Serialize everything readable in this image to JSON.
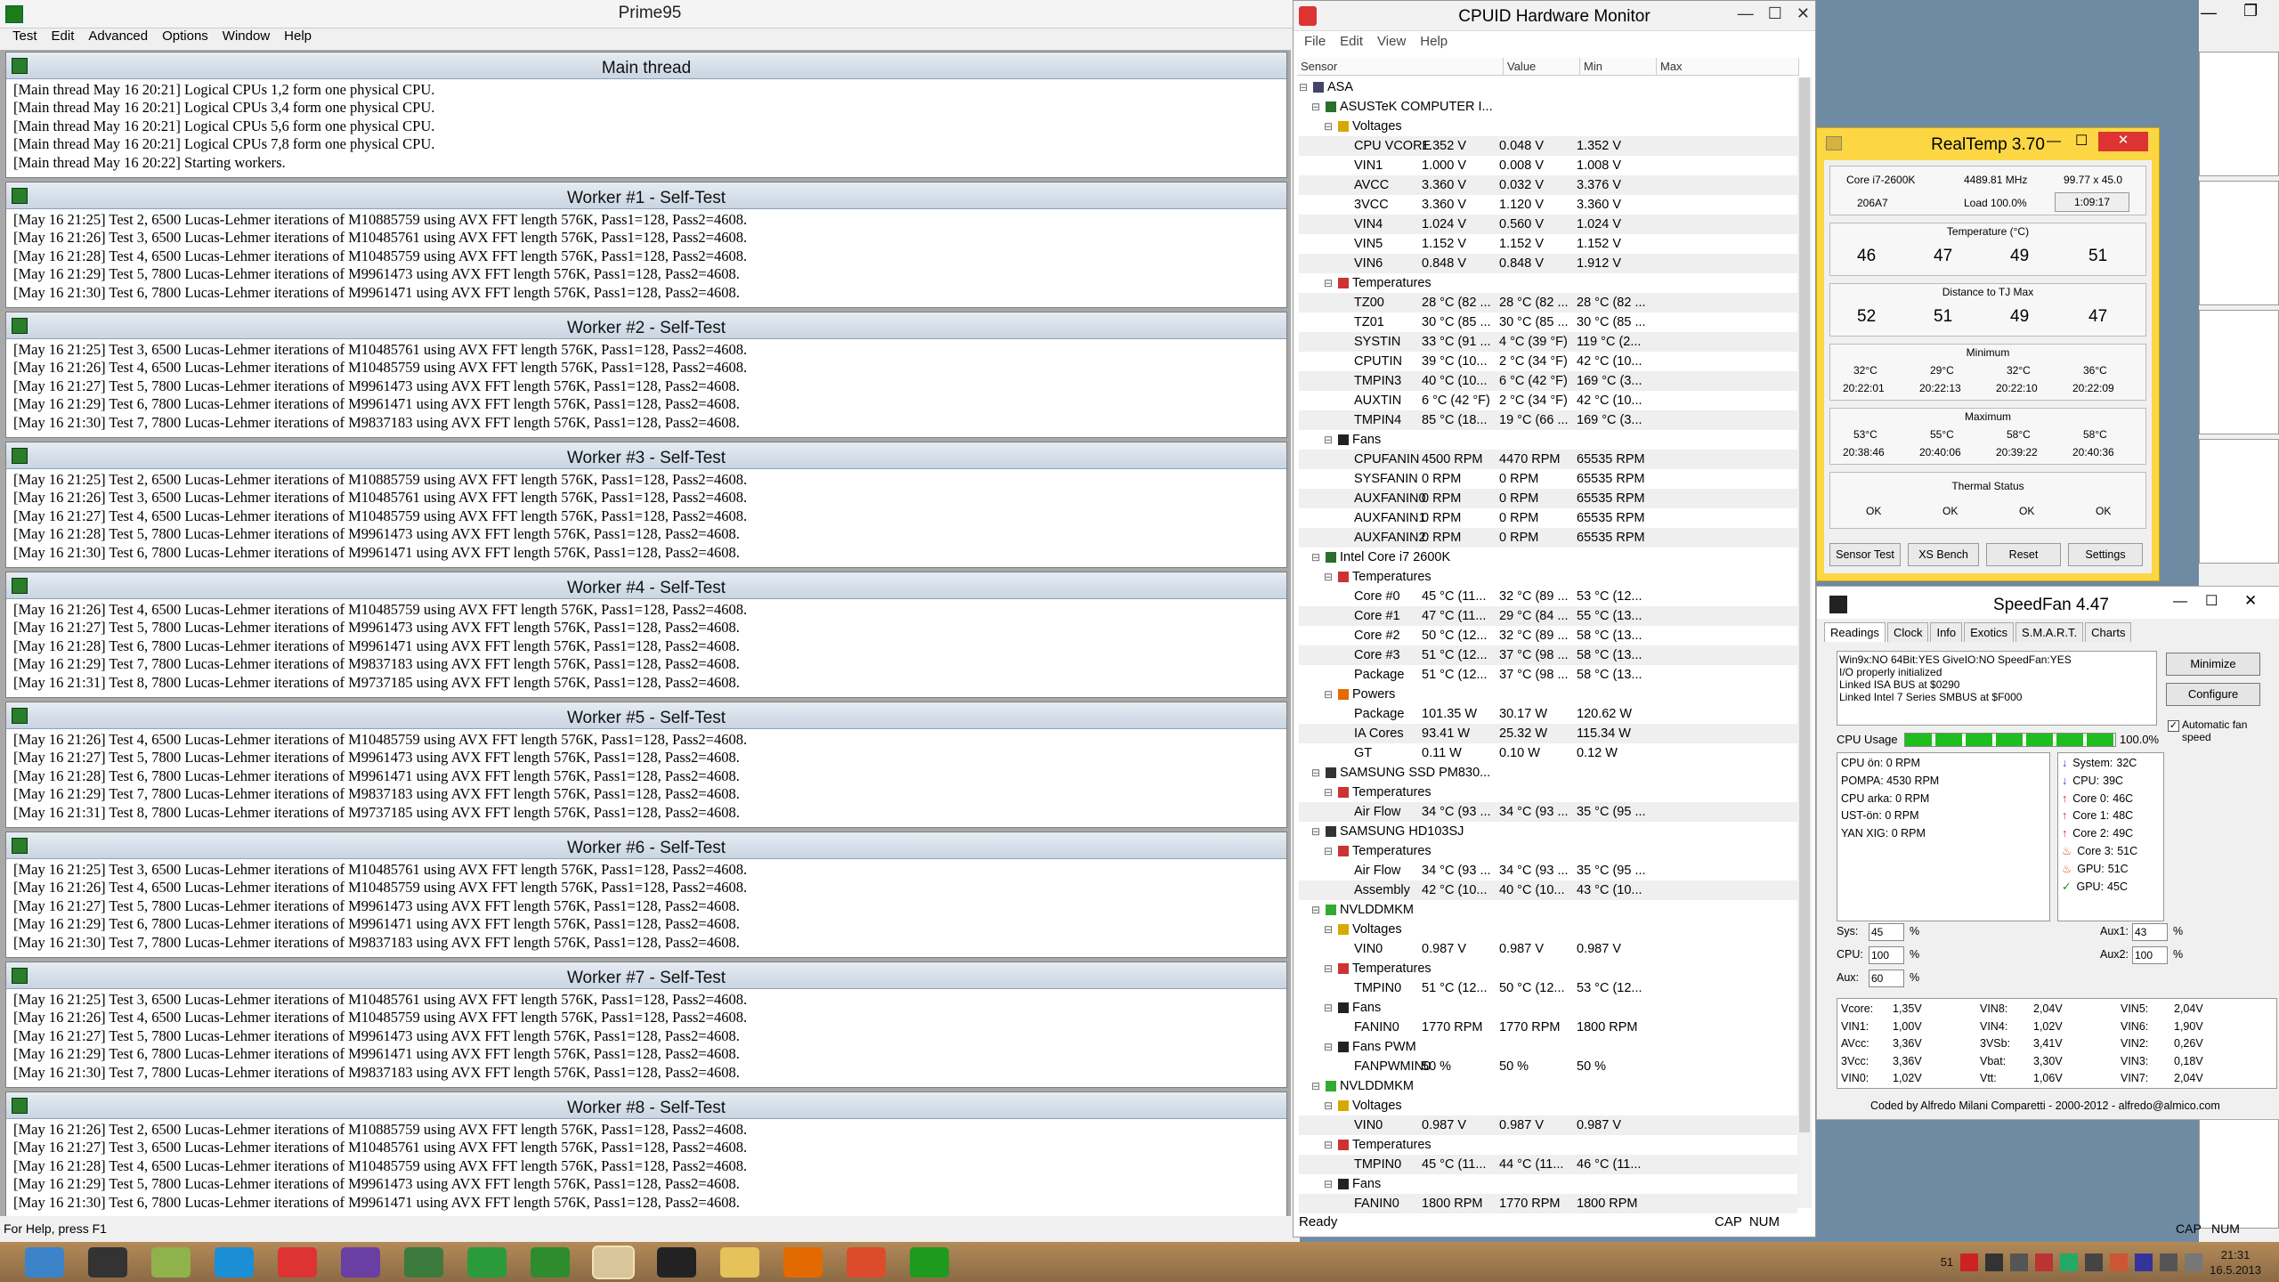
{
  "prime95": {
    "title": "Prime95",
    "menu": [
      "Test",
      "Edit",
      "Advanced",
      "Options",
      "Window",
      "Help"
    ],
    "panes": [
      {
        "title": "Main thread",
        "lines": [
          "[Main thread May 16 20:21] Logical CPUs 1,2 form one physical CPU.",
          "[Main thread May 16 20:21] Logical CPUs 3,4 form one physical CPU.",
          "[Main thread May 16 20:21] Logical CPUs 5,6 form one physical CPU.",
          "[Main thread May 16 20:21] Logical CPUs 7,8 form one physical CPU.",
          "[Main thread May 16 20:22] Starting workers."
        ]
      },
      {
        "title": "Worker #1 - Self-Test",
        "lines": [
          "[May 16 21:25] Test 2, 6500 Lucas-Lehmer iterations of M10885759 using AVX FFT length 576K, Pass1=128, Pass2=4608.",
          "[May 16 21:26] Test 3, 6500 Lucas-Lehmer iterations of M10485761 using AVX FFT length 576K, Pass1=128, Pass2=4608.",
          "[May 16 21:28] Test 4, 6500 Lucas-Lehmer iterations of M10485759 using AVX FFT length 576K, Pass1=128, Pass2=4608.",
          "[May 16 21:29] Test 5, 7800 Lucas-Lehmer iterations of M9961473 using AVX FFT length 576K, Pass1=128, Pass2=4608.",
          "[May 16 21:30] Test 6, 7800 Lucas-Lehmer iterations of M9961471 using AVX FFT length 576K, Pass1=128, Pass2=4608."
        ]
      },
      {
        "title": "Worker #2 - Self-Test",
        "lines": [
          "[May 16 21:25] Test 3, 6500 Lucas-Lehmer iterations of M10485761 using AVX FFT length 576K, Pass1=128, Pass2=4608.",
          "[May 16 21:26] Test 4, 6500 Lucas-Lehmer iterations of M10485759 using AVX FFT length 576K, Pass1=128, Pass2=4608.",
          "[May 16 21:27] Test 5, 7800 Lucas-Lehmer iterations of M9961473 using AVX FFT length 576K, Pass1=128, Pass2=4608.",
          "[May 16 21:29] Test 6, 7800 Lucas-Lehmer iterations of M9961471 using AVX FFT length 576K, Pass1=128, Pass2=4608.",
          "[May 16 21:30] Test 7, 7800 Lucas-Lehmer iterations of M9837183 using AVX FFT length 576K, Pass1=128, Pass2=4608."
        ]
      },
      {
        "title": "Worker #3 - Self-Test",
        "lines": [
          "[May 16 21:25] Test 2, 6500 Lucas-Lehmer iterations of M10885759 using AVX FFT length 576K, Pass1=128, Pass2=4608.",
          "[May 16 21:26] Test 3, 6500 Lucas-Lehmer iterations of M10485761 using AVX FFT length 576K, Pass1=128, Pass2=4608.",
          "[May 16 21:27] Test 4, 6500 Lucas-Lehmer iterations of M10485759 using AVX FFT length 576K, Pass1=128, Pass2=4608.",
          "[May 16 21:28] Test 5, 7800 Lucas-Lehmer iterations of M9961473 using AVX FFT length 576K, Pass1=128, Pass2=4608.",
          "[May 16 21:30] Test 6, 7800 Lucas-Lehmer iterations of M9961471 using AVX FFT length 576K, Pass1=128, Pass2=4608."
        ]
      },
      {
        "title": "Worker #4 - Self-Test",
        "lines": [
          "[May 16 21:26] Test 4, 6500 Lucas-Lehmer iterations of M10485759 using AVX FFT length 576K, Pass1=128, Pass2=4608.",
          "[May 16 21:27] Test 5, 7800 Lucas-Lehmer iterations of M9961473 using AVX FFT length 576K, Pass1=128, Pass2=4608.",
          "[May 16 21:28] Test 6, 7800 Lucas-Lehmer iterations of M9961471 using AVX FFT length 576K, Pass1=128, Pass2=4608.",
          "[May 16 21:29] Test 7, 7800 Lucas-Lehmer iterations of M9837183 using AVX FFT length 576K, Pass1=128, Pass2=4608.",
          "[May 16 21:31] Test 8, 7800 Lucas-Lehmer iterations of M9737185 using AVX FFT length 576K, Pass1=128, Pass2=4608."
        ]
      },
      {
        "title": "Worker #5 - Self-Test",
        "lines": [
          "[May 16 21:26] Test 4, 6500 Lucas-Lehmer iterations of M10485759 using AVX FFT length 576K, Pass1=128, Pass2=4608.",
          "[May 16 21:27] Test 5, 7800 Lucas-Lehmer iterations of M9961473 using AVX FFT length 576K, Pass1=128, Pass2=4608.",
          "[May 16 21:28] Test 6, 7800 Lucas-Lehmer iterations of M9961471 using AVX FFT length 576K, Pass1=128, Pass2=4608.",
          "[May 16 21:29] Test 7, 7800 Lucas-Lehmer iterations of M9837183 using AVX FFT length 576K, Pass1=128, Pass2=4608.",
          "[May 16 21:31] Test 8, 7800 Lucas-Lehmer iterations of M9737185 using AVX FFT length 576K, Pass1=128, Pass2=4608."
        ]
      },
      {
        "title": "Worker #6 - Self-Test",
        "lines": [
          "[May 16 21:25] Test 3, 6500 Lucas-Lehmer iterations of M10485761 using AVX FFT length 576K, Pass1=128, Pass2=4608.",
          "[May 16 21:26] Test 4, 6500 Lucas-Lehmer iterations of M10485759 using AVX FFT length 576K, Pass1=128, Pass2=4608.",
          "[May 16 21:27] Test 5, 7800 Lucas-Lehmer iterations of M9961473 using AVX FFT length 576K, Pass1=128, Pass2=4608.",
          "[May 16 21:29] Test 6, 7800 Lucas-Lehmer iterations of M9961471 using AVX FFT length 576K, Pass1=128, Pass2=4608.",
          "[May 16 21:30] Test 7, 7800 Lucas-Lehmer iterations of M9837183 using AVX FFT length 576K, Pass1=128, Pass2=4608."
        ]
      },
      {
        "title": "Worker #7 - Self-Test",
        "lines": [
          "[May 16 21:25] Test 3, 6500 Lucas-Lehmer iterations of M10485761 using AVX FFT length 576K, Pass1=128, Pass2=4608.",
          "[May 16 21:26] Test 4, 6500 Lucas-Lehmer iterations of M10485759 using AVX FFT length 576K, Pass1=128, Pass2=4608.",
          "[May 16 21:27] Test 5, 7800 Lucas-Lehmer iterations of M9961473 using AVX FFT length 576K, Pass1=128, Pass2=4608.",
          "[May 16 21:29] Test 6, 7800 Lucas-Lehmer iterations of M9961471 using AVX FFT length 576K, Pass1=128, Pass2=4608.",
          "[May 16 21:30] Test 7, 7800 Lucas-Lehmer iterations of M9837183 using AVX FFT length 576K, Pass1=128, Pass2=4608."
        ]
      },
      {
        "title": "Worker #8 - Self-Test",
        "lines": [
          "[May 16 21:26] Test 2, 6500 Lucas-Lehmer iterations of M10885759 using AVX FFT length 576K, Pass1=128, Pass2=4608.",
          "[May 16 21:27] Test 3, 6500 Lucas-Lehmer iterations of M10485761 using AVX FFT length 576K, Pass1=128, Pass2=4608.",
          "[May 16 21:28] Test 4, 6500 Lucas-Lehmer iterations of M10485759 using AVX FFT length 576K, Pass1=128, Pass2=4608.",
          "[May 16 21:29] Test 5, 7800 Lucas-Lehmer iterations of M9961473 using AVX FFT length 576K, Pass1=128, Pass2=4608.",
          "[May 16 21:30] Test 6, 7800 Lucas-Lehmer iterations of M9961471 using AVX FFT length 576K, Pass1=128, Pass2=4608."
        ]
      }
    ],
    "status": "For Help, press F1",
    "caps": "CAP",
    "num": "NUM"
  },
  "cpuid": {
    "title": "CPUID Hardware Monitor",
    "menu": [
      "File",
      "Edit",
      "View",
      "Help"
    ],
    "columns": [
      "Sensor",
      "Value",
      "Min",
      "Max"
    ],
    "rows": [
      {
        "i": 0,
        "k": "root",
        "n": "ASA"
      },
      {
        "i": 1,
        "k": "dev",
        "n": "ASUSTeK COMPUTER I..."
      },
      {
        "i": 2,
        "k": "volt",
        "n": "Voltages"
      },
      {
        "i": 3,
        "n": "CPU VCORE",
        "v": "1.352 V",
        "mn": "0.048 V",
        "mx": "1.352 V"
      },
      {
        "i": 3,
        "n": "VIN1",
        "v": "1.000 V",
        "mn": "0.008 V",
        "mx": "1.008 V"
      },
      {
        "i": 3,
        "n": "AVCC",
        "v": "3.360 V",
        "mn": "0.032 V",
        "mx": "3.376 V"
      },
      {
        "i": 3,
        "n": "3VCC",
        "v": "3.360 V",
        "mn": "1.120 V",
        "mx": "3.360 V"
      },
      {
        "i": 3,
        "n": "VIN4",
        "v": "1.024 V",
        "mn": "0.560 V",
        "mx": "1.024 V"
      },
      {
        "i": 3,
        "n": "VIN5",
        "v": "1.152 V",
        "mn": "1.152 V",
        "mx": "1.152 V"
      },
      {
        "i": 3,
        "n": "VIN6",
        "v": "0.848 V",
        "mn": "0.848 V",
        "mx": "1.912 V"
      },
      {
        "i": 2,
        "k": "temp",
        "n": "Temperatures"
      },
      {
        "i": 3,
        "n": "TZ00",
        "v": "28 °C (82 ...",
        "mn": "28 °C (82 ...",
        "mx": "28 °C (82 ..."
      },
      {
        "i": 3,
        "n": "TZ01",
        "v": "30 °C (85 ...",
        "mn": "30 °C (85 ...",
        "mx": "30 °C (85 ..."
      },
      {
        "i": 3,
        "n": "SYSTIN",
        "v": "33 °C (91 ...",
        "mn": "4 °C (39 °F)",
        "mx": "119 °C (2..."
      },
      {
        "i": 3,
        "n": "CPUTIN",
        "v": "39 °C (10...",
        "mn": "2 °C (34 °F)",
        "mx": "42 °C (10..."
      },
      {
        "i": 3,
        "n": "TMPIN3",
        "v": "40 °C (10...",
        "mn": "6 °C (42 °F)",
        "mx": "169 °C (3..."
      },
      {
        "i": 3,
        "n": "AUXTIN",
        "v": "6 °C (42 °F)",
        "mn": "2 °C (34 °F)",
        "mx": "42 °C (10..."
      },
      {
        "i": 3,
        "n": "TMPIN4",
        "v": "85 °C (18...",
        "mn": "19 °C (66 ...",
        "mx": "169 °C (3..."
      },
      {
        "i": 2,
        "k": "fan",
        "n": "Fans"
      },
      {
        "i": 3,
        "n": "CPUFANIN",
        "v": "4500 RPM",
        "mn": "4470 RPM",
        "mx": "65535 RPM"
      },
      {
        "i": 3,
        "n": "SYSFANIN",
        "v": "0 RPM",
        "mn": "0 RPM",
        "mx": "65535 RPM"
      },
      {
        "i": 3,
        "n": "AUXFANIN0",
        "v": "0 RPM",
        "mn": "0 RPM",
        "mx": "65535 RPM"
      },
      {
        "i": 3,
        "n": "AUXFANIN1",
        "v": "0 RPM",
        "mn": "0 RPM",
        "mx": "65535 RPM"
      },
      {
        "i": 3,
        "n": "AUXFANIN2",
        "v": "0 RPM",
        "mn": "0 RPM",
        "mx": "65535 RPM"
      },
      {
        "i": 1,
        "k": "dev",
        "n": "Intel Core i7 2600K"
      },
      {
        "i": 2,
        "k": "temp",
        "n": "Temperatures"
      },
      {
        "i": 3,
        "n": "Core #0",
        "v": "45 °C (11...",
        "mn": "32 °C (89 ...",
        "mx": "53 °C (12..."
      },
      {
        "i": 3,
        "n": "Core #1",
        "v": "47 °C (11...",
        "mn": "29 °C (84 ...",
        "mx": "55 °C (13..."
      },
      {
        "i": 3,
        "n": "Core #2",
        "v": "50 °C (12...",
        "mn": "32 °C (89 ...",
        "mx": "58 °C (13..."
      },
      {
        "i": 3,
        "n": "Core #3",
        "v": "51 °C (12...",
        "mn": "37 °C (98 ...",
        "mx": "58 °C (13..."
      },
      {
        "i": 3,
        "n": "Package",
        "v": "51 °C (12...",
        "mn": "37 °C (98 ...",
        "mx": "58 °C (13..."
      },
      {
        "i": 2,
        "k": "pow",
        "n": "Powers"
      },
      {
        "i": 3,
        "n": "Package",
        "v": "101.35 W",
        "mn": "30.17 W",
        "mx": "120.62 W"
      },
      {
        "i": 3,
        "n": "IA Cores",
        "v": "93.41 W",
        "mn": "25.32 W",
        "mx": "115.34 W"
      },
      {
        "i": 3,
        "n": "GT",
        "v": "0.11 W",
        "mn": "0.10 W",
        "mx": "0.12 W"
      },
      {
        "i": 1,
        "k": "disk",
        "n": "SAMSUNG SSD PM830..."
      },
      {
        "i": 2,
        "k": "temp",
        "n": "Temperatures"
      },
      {
        "i": 3,
        "n": "Air Flow",
        "v": "34 °C (93 ...",
        "mn": "34 °C (93 ...",
        "mx": "35 °C (95 ..."
      },
      {
        "i": 1,
        "k": "disk",
        "n": "SAMSUNG HD103SJ"
      },
      {
        "i": 2,
        "k": "temp",
        "n": "Temperatures"
      },
      {
        "i": 3,
        "n": "Air Flow",
        "v": "34 °C (93 ...",
        "mn": "34 °C (93 ...",
        "mx": "35 °C (95 ..."
      },
      {
        "i": 3,
        "n": "Assembly",
        "v": "42 °C (10...",
        "mn": "40 °C (10...",
        "mx": "43 °C (10..."
      },
      {
        "i": 1,
        "k": "gpu",
        "n": "NVLDDMKM"
      },
      {
        "i": 2,
        "k": "volt",
        "n": "Voltages"
      },
      {
        "i": 3,
        "n": "VIN0",
        "v": "0.987 V",
        "mn": "0.987 V",
        "mx": "0.987 V"
      },
      {
        "i": 2,
        "k": "temp",
        "n": "Temperatures"
      },
      {
        "i": 3,
        "n": "TMPIN0",
        "v": "51 °C (12...",
        "mn": "50 °C (12...",
        "mx": "53 °C (12..."
      },
      {
        "i": 2,
        "k": "fan",
        "n": "Fans"
      },
      {
        "i": 3,
        "n": "FANIN0",
        "v": "1770 RPM",
        "mn": "1770 RPM",
        "mx": "1800 RPM"
      },
      {
        "i": 2,
        "k": "fan",
        "n": "Fans PWM"
      },
      {
        "i": 3,
        "n": "FANPWMIN0",
        "v": "50 %",
        "mn": "50 %",
        "mx": "50 %"
      },
      {
        "i": 1,
        "k": "gpu",
        "n": "NVLDDMKM"
      },
      {
        "i": 2,
        "k": "volt",
        "n": "Voltages"
      },
      {
        "i": 3,
        "n": "VIN0",
        "v": "0.987 V",
        "mn": "0.987 V",
        "mx": "0.987 V"
      },
      {
        "i": 2,
        "k": "temp",
        "n": "Temperatures"
      },
      {
        "i": 3,
        "n": "TMPIN0",
        "v": "45 °C (11...",
        "mn": "44 °C (11...",
        "mx": "46 °C (11..."
      },
      {
        "i": 2,
        "k": "fan",
        "n": "Fans"
      },
      {
        "i": 3,
        "n": "FANIN0",
        "v": "1800 RPM",
        "mn": "1770 RPM",
        "mx": "1800 RPM"
      }
    ],
    "status": "Ready",
    "caps": "CAP",
    "num": "NUM"
  },
  "realtemp": {
    "title": "RealTemp 3.70",
    "cpu": "Core i7-2600K",
    "mhz": "4489.81 MHz",
    "mult": "99.77 x 45.0",
    "id": "206A7",
    "load": "Load 100.0%",
    "timer": "1:09:17",
    "temp_label": "Temperature (°C)",
    "temps": [
      "46",
      "47",
      "49",
      "51"
    ],
    "dist_label": "Distance to TJ Max",
    "dist": [
      "52",
      "51",
      "49",
      "47"
    ],
    "min_label": "Minimum",
    "min": [
      "32°C",
      "29°C",
      "32°C",
      "36°C"
    ],
    "min_t": [
      "20:22:01",
      "20:22:13",
      "20:22:10",
      "20:22:09"
    ],
    "max_label": "Maximum",
    "max": [
      "53°C",
      "55°C",
      "58°C",
      "58°C"
    ],
    "max_t": [
      "20:38:46",
      "20:40:06",
      "20:39:22",
      "20:40:36"
    ],
    "thermal_label": "Thermal Status",
    "thermal": [
      "OK",
      "OK",
      "OK",
      "OK"
    ],
    "buttons": [
      "Sensor Test",
      "XS Bench",
      "Reset",
      "Settings"
    ]
  },
  "speedfan": {
    "title": "SpeedFan 4.47",
    "tabs": [
      "Readings",
      "Clock",
      "Info",
      "Exotics",
      "S.M.A.R.T.",
      "Charts"
    ],
    "log": [
      "Win9x:NO  64Bit:YES  GiveIO:NO  SpeedFan:YES",
      "I/O properly initialized",
      "Linked ISA BUS at $0290",
      "Linked Intel 7 Series SMBUS at $F000"
    ],
    "minimize": "Minimize",
    "configure": "Configure",
    "cpu_usage_label": "CPU Usage",
    "cpu_usage": "100.0%",
    "cpu_usage_fraction": 1.0,
    "auto_fan": "Automatic fan speed",
    "fans": [
      "CPU ön:  0 RPM",
      "POMPA:  4530 RPM",
      "CPU arka: 0 RPM",
      "UST-ön:  0 RPM",
      "YAN XIG:  0 RPM"
    ],
    "temps": [
      {
        "n": "System:",
        "v": "32C",
        "i": "down"
      },
      {
        "n": "CPU:",
        "v": "39C",
        "i": "down"
      },
      {
        "n": "Core 0:",
        "v": "46C",
        "i": "up"
      },
      {
        "n": "Core 1:",
        "v": "48C",
        "i": "up"
      },
      {
        "n": "Core 2:",
        "v": "49C",
        "i": "up"
      },
      {
        "n": "Core 3:",
        "v": "51C",
        "i": "fire"
      },
      {
        "n": "GPU:",
        "v": "51C",
        "i": "fire"
      },
      {
        "n": "GPU:",
        "v": "45C",
        "i": "check"
      }
    ],
    "speeds": [
      {
        "l": "Sys:",
        "v": "45"
      },
      {
        "l": "CPU:",
        "v": "100"
      },
      {
        "l": "Aux:",
        "v": "60"
      }
    ],
    "aux": [
      {
        "l": "Aux1:",
        "v": "43"
      },
      {
        "l": "Aux2:",
        "v": "100"
      }
    ],
    "pct": "%",
    "volts": [
      [
        "Vcore:",
        "1,35V",
        "VIN8:",
        "2,04V",
        "VIN5:",
        "2,04V"
      ],
      [
        "VIN1:",
        "1,00V",
        "VIN4:",
        "1,02V",
        "VIN6:",
        "1,90V"
      ],
      [
        "AVcc:",
        "3,36V",
        "3VSb:",
        "3,41V",
        "VIN2:",
        "0,26V"
      ],
      [
        "3Vcc:",
        "3,36V",
        "Vbat:",
        "3,30V",
        "VIN3:",
        "0,18V"
      ],
      [
        "VIN0:",
        "1,02V",
        "Vtt:",
        "1,06V",
        "VIN7:",
        "2,04V"
      ]
    ],
    "footer": "Coded by Alfredo Milani Comparetti - 2000-2012 - alfredo@almico.com"
  },
  "taskbar": {
    "time": "21:31",
    "date": "16.5.2013",
    "tray_num": "51"
  }
}
